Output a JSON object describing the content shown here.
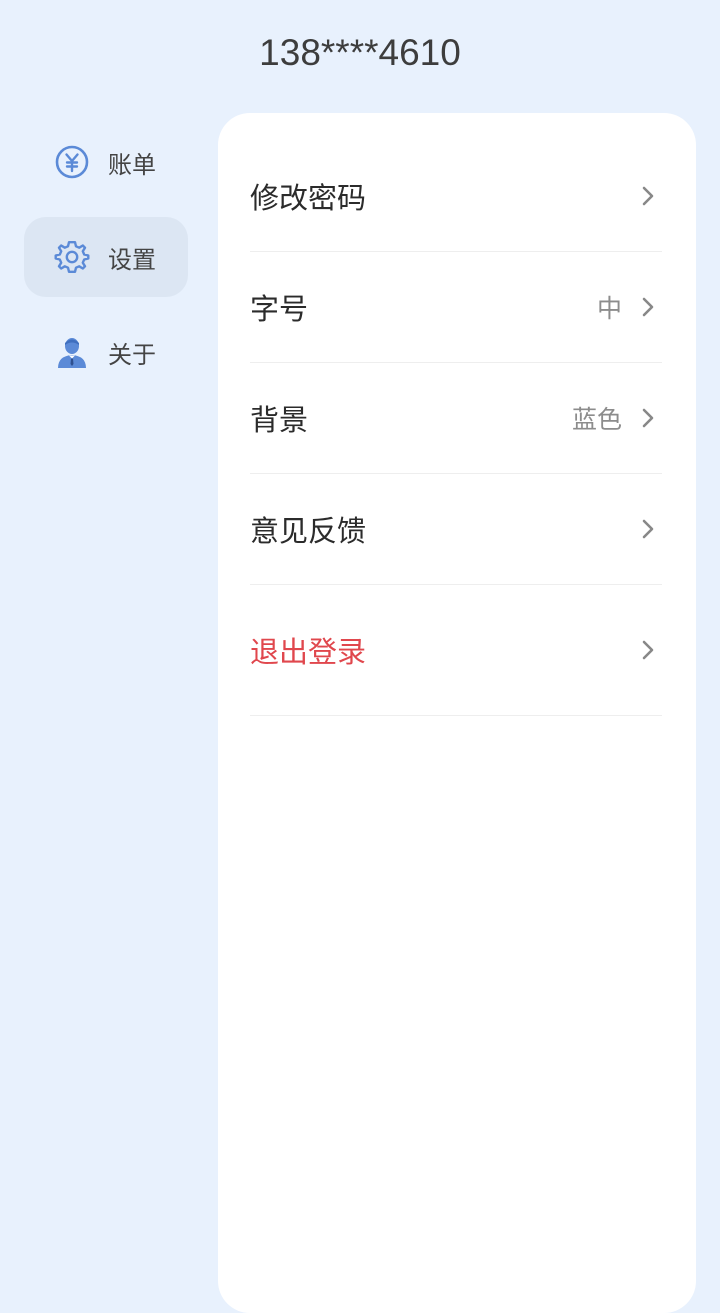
{
  "header": {
    "phone": "138****4610"
  },
  "sidebar": {
    "items": [
      {
        "label": "账单",
        "icon": "yuan-icon"
      },
      {
        "label": "设置",
        "icon": "gear-icon",
        "active": true
      },
      {
        "label": "关于",
        "icon": "person-icon"
      }
    ]
  },
  "settings": {
    "change_password": {
      "label": "修改密码"
    },
    "font_size": {
      "label": "字号",
      "value": "中"
    },
    "background": {
      "label": "背景",
      "value": "蓝色"
    },
    "feedback": {
      "label": "意见反馈"
    },
    "logout": {
      "label": "退出登录"
    }
  },
  "colors": {
    "page_bg": "#e8f1fd",
    "accent_blue": "#5b8ad7",
    "danger_red": "#e0474d",
    "active_item_bg": "#dce6f3"
  }
}
